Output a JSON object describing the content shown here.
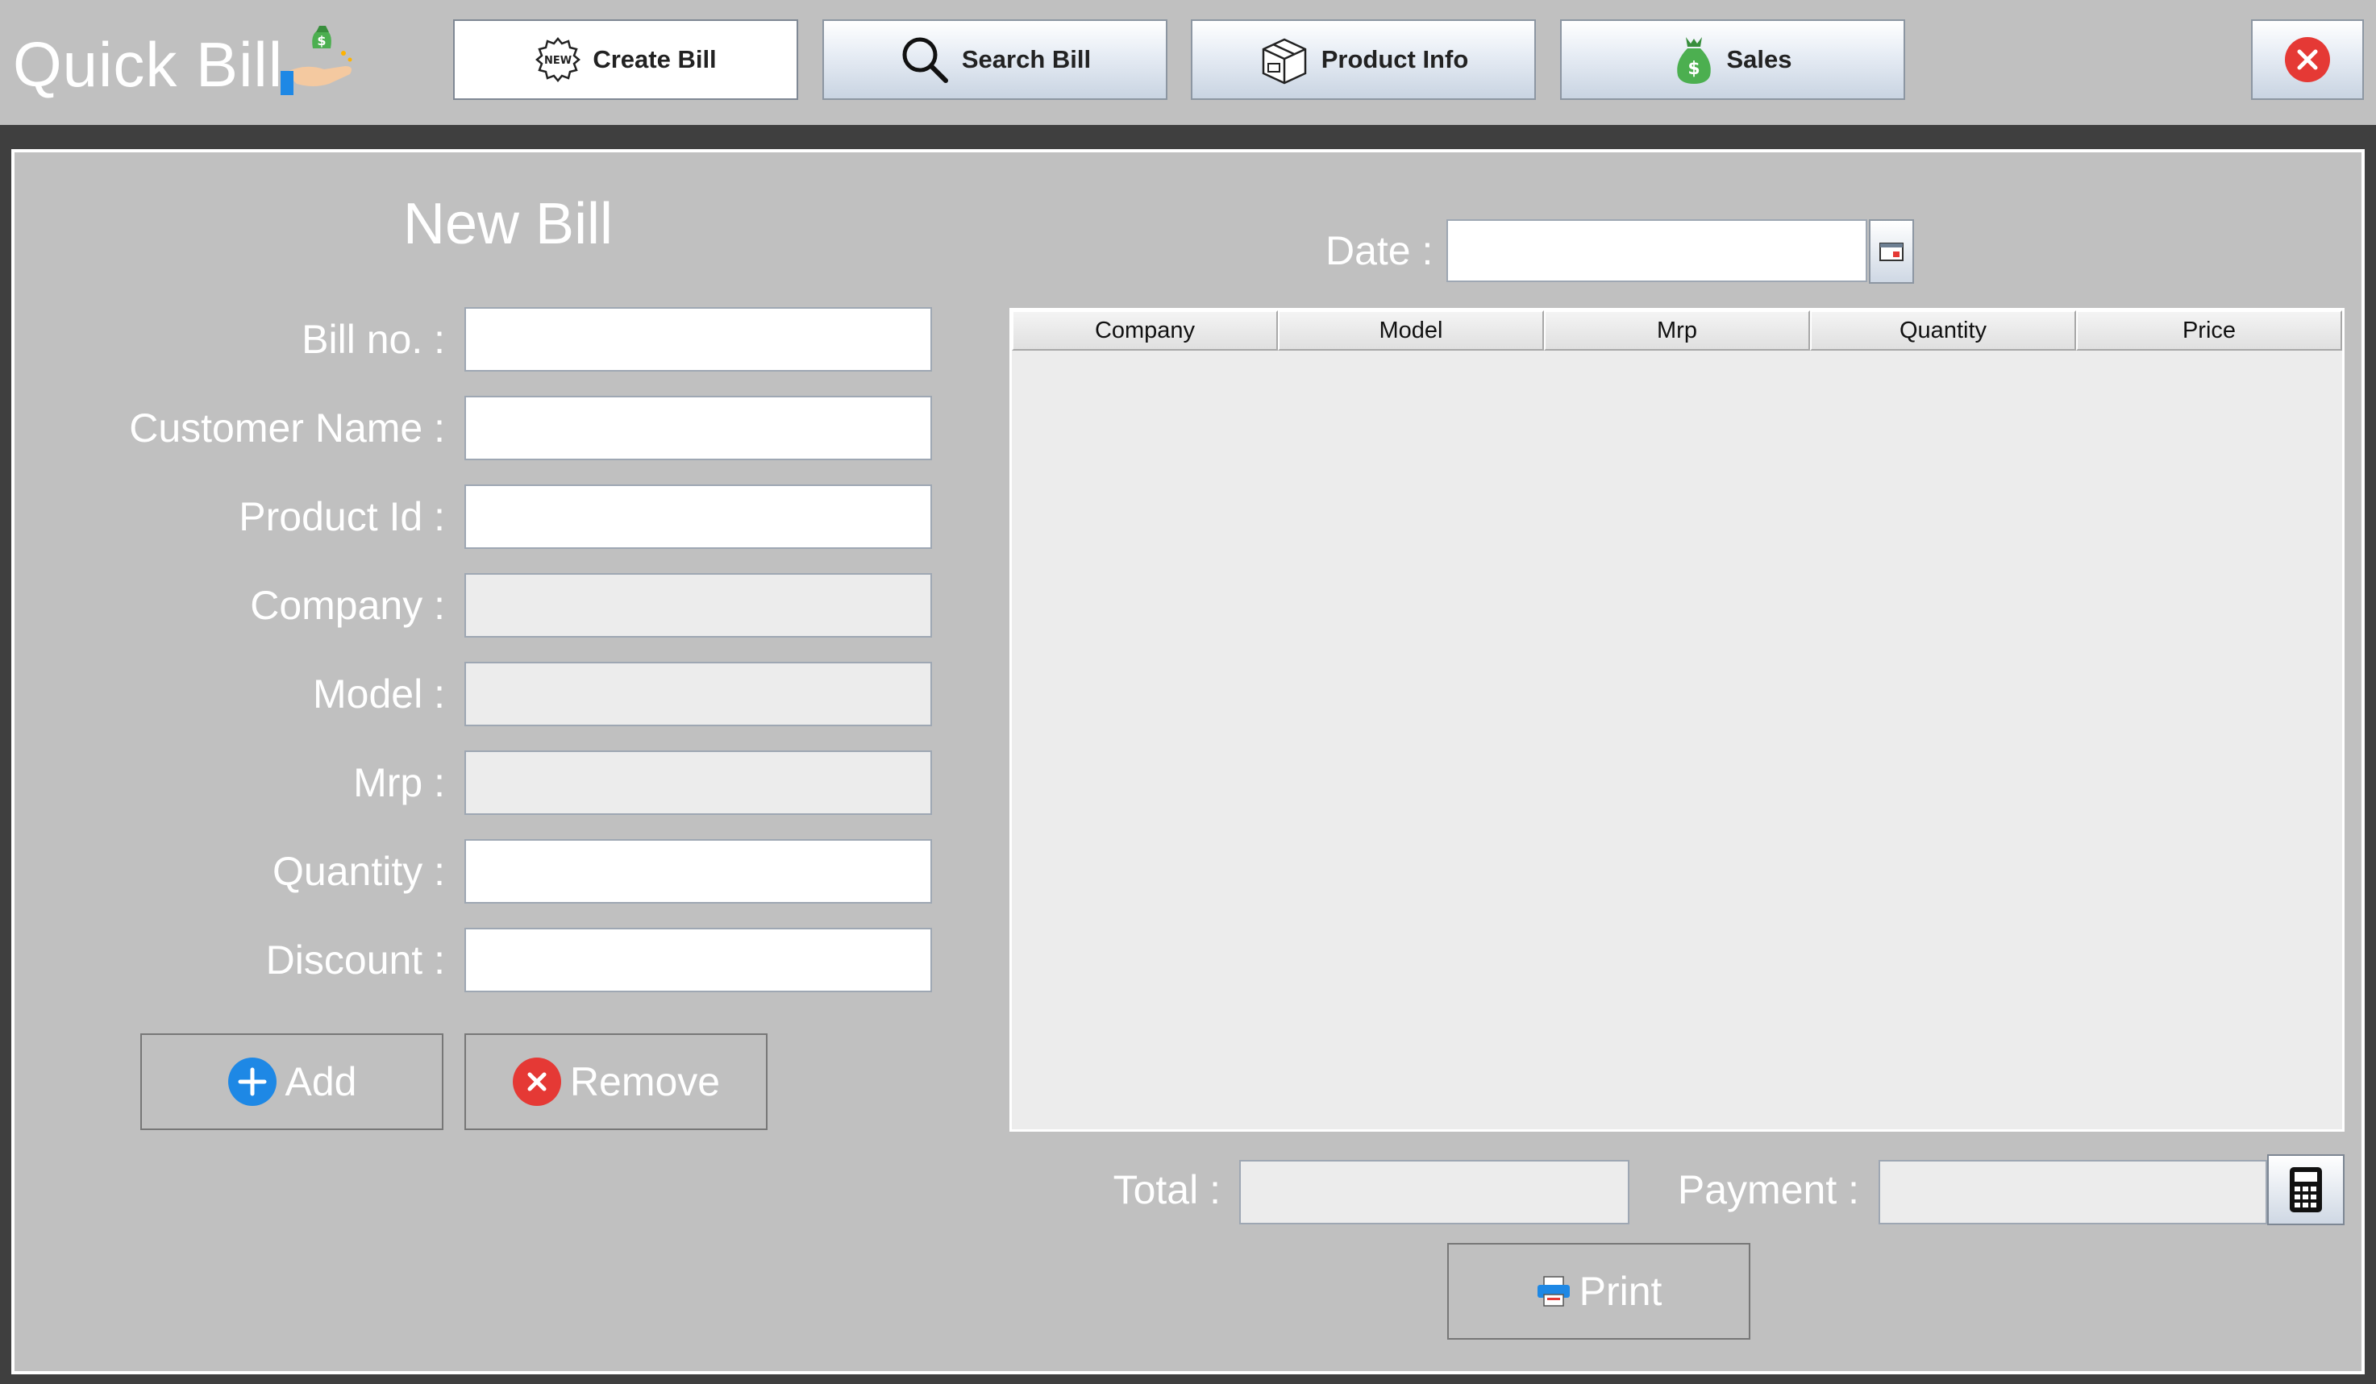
{
  "app": {
    "title": "Quick Bill"
  },
  "nav": {
    "create_bill": "Create Bill",
    "search_bill": "Search Bill",
    "product_info": "Product Info",
    "sales": "Sales",
    "new_badge": "NEW"
  },
  "form": {
    "title": "New Bill",
    "bill_no_label": "Bill no. :",
    "customer_name_label": "Customer  Name :",
    "product_id_label": "Product Id :",
    "company_label": "Company :",
    "model_label": "Model :",
    "mrp_label": "Mrp :",
    "quantity_label": "Quantity :",
    "discount_label": "Discount :",
    "values": {
      "bill_no": "",
      "customer_name": "",
      "product_id": "",
      "company": "",
      "model": "",
      "mrp": "",
      "quantity": "",
      "discount": ""
    },
    "add_label": "Add",
    "remove_label": "Remove"
  },
  "date": {
    "label": "Date :",
    "value": ""
  },
  "table": {
    "columns": [
      "Company",
      "Model",
      "Mrp",
      "Quantity",
      "Price"
    ],
    "rows": []
  },
  "totals": {
    "total_label": "Total :",
    "payment_label": "Payment :",
    "total_value": "",
    "payment_value": ""
  },
  "print_label": "Print",
  "colors": {
    "background": "#c0c0c0",
    "dark_strip": "#3f3f3f",
    "add_blue": "#1e88e5",
    "remove_red": "#e53935",
    "sales_green": "#4caf50"
  }
}
